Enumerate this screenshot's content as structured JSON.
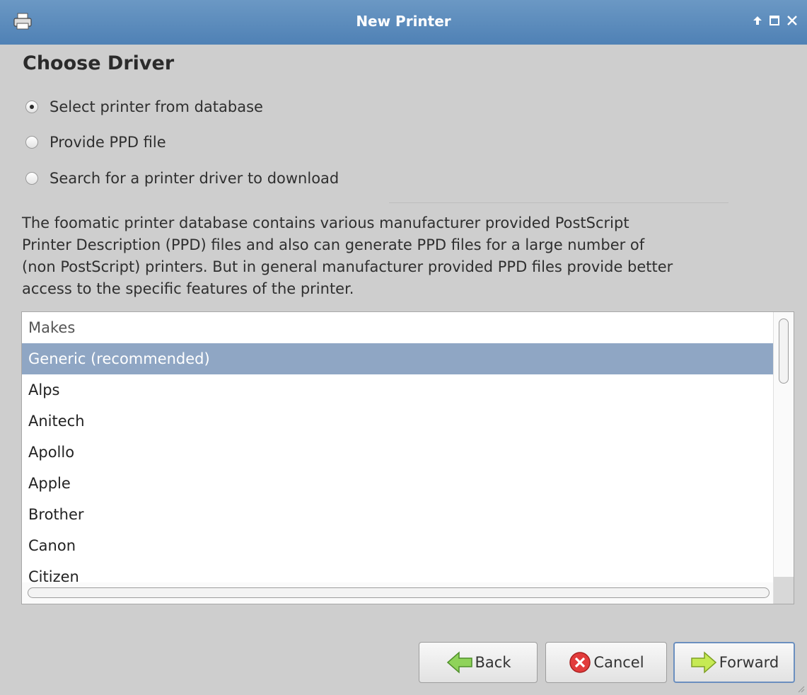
{
  "window": {
    "title": "New Printer",
    "controls": [
      "arrow-up-icon",
      "maximize-icon",
      "close-icon"
    ]
  },
  "page": {
    "heading": "Choose Driver"
  },
  "driver_options": [
    {
      "label": "Select printer from database",
      "checked": true
    },
    {
      "label": "Provide PPD file",
      "checked": false
    },
    {
      "label": "Search for a printer driver to download",
      "checked": false
    }
  ],
  "description": [
    "The foomatic printer database contains various manufacturer provided PostScript",
    "Printer Description (PPD) files and also can generate PPD files for a large number of",
    "(non PostScript) printers. But in general manufacturer provided PPD files provide better",
    "access to the specific features of the printer."
  ],
  "makes_list": {
    "header": "Makes",
    "items": [
      "Generic (recommended)",
      "Alps",
      "Anitech",
      "Apollo",
      "Apple",
      "Brother",
      "Canon",
      "Citizen"
    ],
    "selected_index": 0
  },
  "buttons": {
    "back": "Back",
    "cancel": "Cancel",
    "forward": "Forward"
  },
  "colors": {
    "titlebar": "#5a8abb",
    "selection": "#8fa6c4",
    "window_bg": "#cecece"
  }
}
